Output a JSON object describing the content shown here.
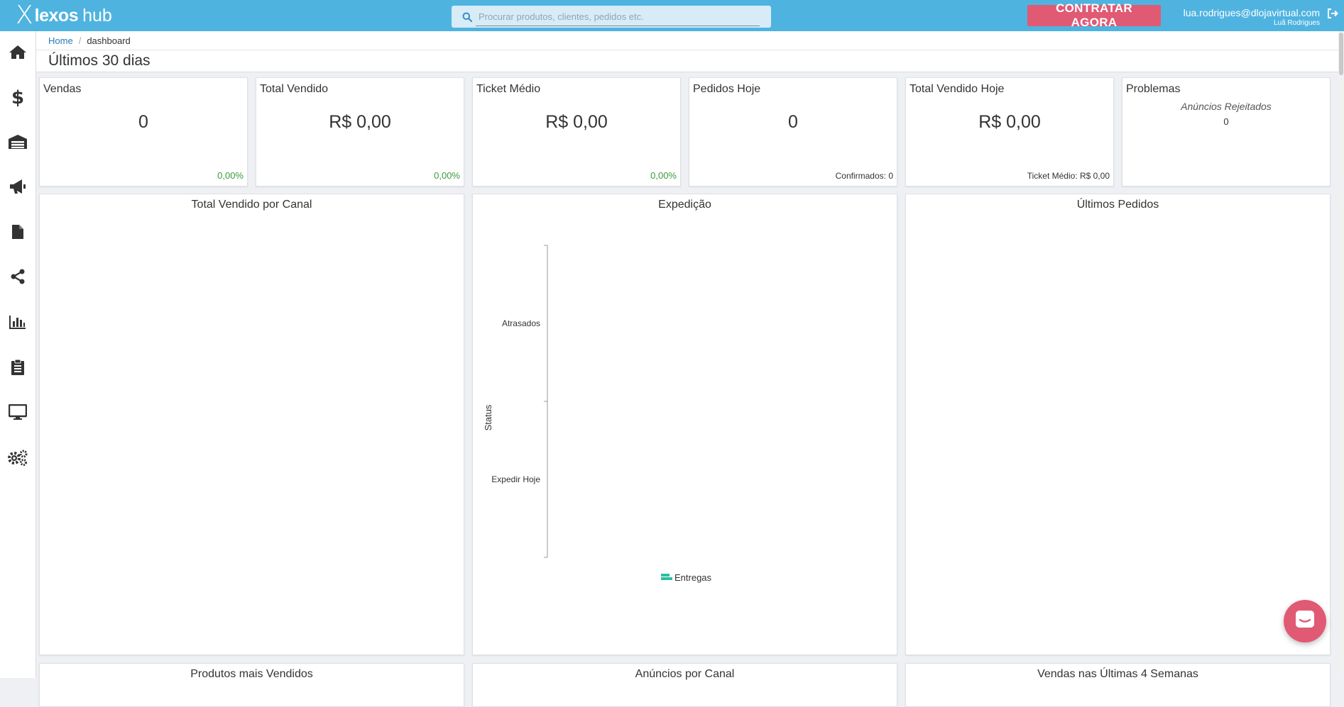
{
  "app": {
    "logo_mark": "X",
    "logo_name": "lexos",
    "logo_suffix": "hub"
  },
  "header": {
    "search_placeholder": "Procurar produtos, clientes, pedidos etc.",
    "cta_label": "CONTRATAR AGORA",
    "user_email": "lua.rodrigues@dlojavirtual.com",
    "user_name": "Luã Rodrigues"
  },
  "sidebar": {
    "items": [
      {
        "icon": "home-icon"
      },
      {
        "icon": "dollar-icon"
      },
      {
        "icon": "warehouse-icon"
      },
      {
        "icon": "megaphone-icon"
      },
      {
        "icon": "document-icon"
      },
      {
        "icon": "share-icon"
      },
      {
        "icon": "bar-chart-icon"
      },
      {
        "icon": "clipboard-icon"
      },
      {
        "icon": "monitor-icon"
      },
      {
        "icon": "gears-icon"
      }
    ]
  },
  "breadcrumb": {
    "home": "Home",
    "current": "dashboard"
  },
  "page": {
    "title": "Últimos 30 dias"
  },
  "stats": {
    "vendas": {
      "title": "Vendas",
      "value": "0",
      "pct": "0,00%"
    },
    "total_vendido": {
      "title": "Total Vendido",
      "value": "R$ 0,00",
      "pct": "0,00%"
    },
    "ticket_medio": {
      "title": "Ticket Médio",
      "value": "R$ 0,00",
      "pct": "0,00%"
    },
    "pedidos_hoje": {
      "title": "Pedidos Hoje",
      "value": "0",
      "foot": "Confirmados: 0"
    },
    "total_vendido_hoje": {
      "title": "Total Vendido Hoje",
      "value": "R$ 0,00",
      "foot": "Ticket Médio: R$ 0,00"
    },
    "problemas": {
      "title": "Problemas",
      "sub": "Anúncios Rejeitados",
      "value": "0"
    }
  },
  "panels": {
    "canal": {
      "title": "Total Vendido por Canal"
    },
    "expedicao": {
      "title": "Expedição"
    },
    "ultimos_pedidos": {
      "title": "Últimos Pedidos"
    },
    "produtos": {
      "title": "Produtos mais Vendidos"
    },
    "anuncios": {
      "title": "Anúncios por Canal"
    },
    "vendas_semanas": {
      "title": "Vendas nas Últimas 4 Semanas"
    }
  },
  "chart_data": {
    "type": "bar",
    "orientation": "horizontal",
    "title": "Expedição",
    "ylabel": "Status",
    "categories": [
      "Atrasados",
      "Expedir Hoje"
    ],
    "series": [
      {
        "name": "Entregas",
        "values": [
          0,
          0
        ],
        "color": "#2bbfa0"
      }
    ],
    "legend": "bottom",
    "grid": false
  }
}
